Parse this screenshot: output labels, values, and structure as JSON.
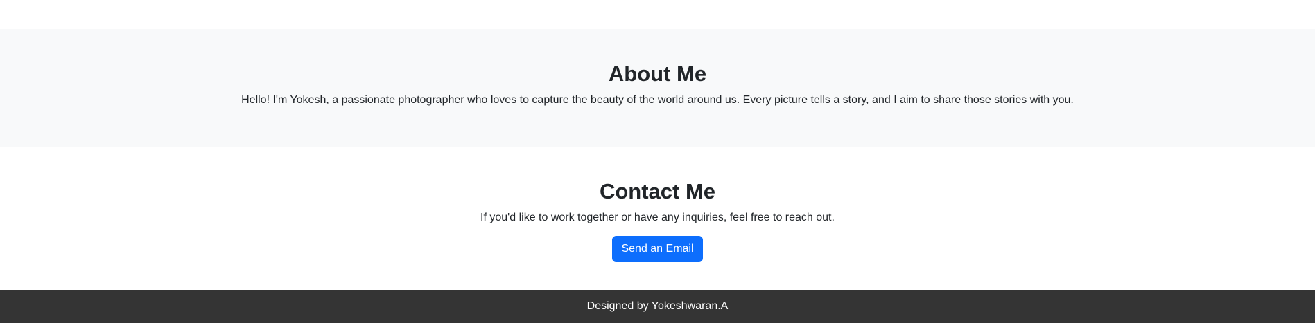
{
  "about": {
    "title": "About Me",
    "text": "Hello! I'm Yokesh, a passionate photographer who loves to capture the beauty of the world around us. Every picture tells a story, and I aim to share those stories with you."
  },
  "contact": {
    "title": "Contact Me",
    "text": "If you'd like to work together or have any inquiries, feel free to reach out.",
    "button_label": "Send an Email"
  },
  "footer": {
    "text": "Designed by Yokeshwaran.A"
  },
  "colors": {
    "about_bg": "#f8f9fa",
    "button_bg": "#0d6efd",
    "footer_bg": "#343434",
    "text": "#212529"
  }
}
